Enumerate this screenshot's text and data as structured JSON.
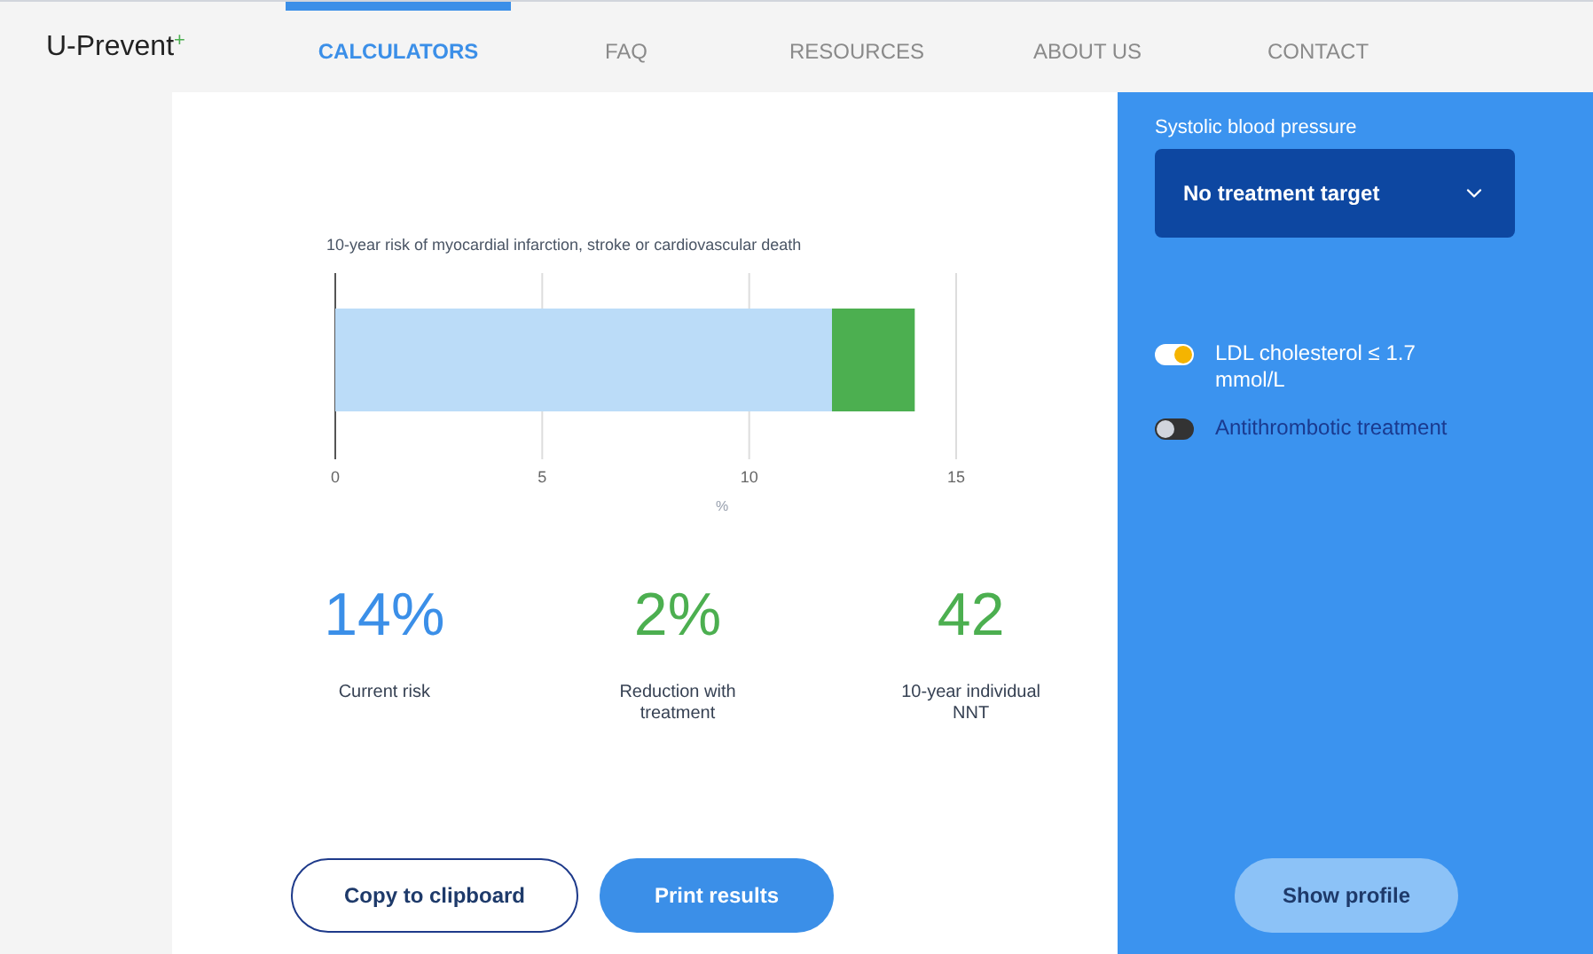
{
  "logo": {
    "text": "U-Prevent",
    "mark": "+"
  },
  "nav": [
    {
      "label": "CALCULATORS",
      "selected": true
    },
    {
      "label": "FAQ",
      "selected": false
    },
    {
      "label": "RESOURCES",
      "selected": false
    },
    {
      "label": "ABOUT US",
      "selected": false
    },
    {
      "label": "CONTACT",
      "selected": false
    }
  ],
  "chart": {
    "chart_data": {
      "type": "bar",
      "title": "10-year risk of myocardial infarction, stroke or cardiovascular death",
      "xlabel": "%",
      "orientation": "horizontal",
      "stacked": true,
      "series": [
        {
          "color": "#bbdcf8",
          "values": [
            12
          ]
        },
        {
          "color": "#4caf50",
          "values": [
            2
          ]
        }
      ],
      "xlim": [
        0,
        15
      ],
      "xticks": [
        0,
        5,
        10,
        15
      ]
    }
  },
  "stats": [
    {
      "value": "14%",
      "label": "Current risk",
      "color": "#3b8fe8"
    },
    {
      "value": "2%",
      "label": "Reduction with treatment",
      "color": "#4caf50"
    },
    {
      "value": "42",
      "label": "10-year individual NNT",
      "color": "#4caf50"
    }
  ],
  "buttons": [
    {
      "label": "Copy to clipboard",
      "kind": "outline"
    },
    {
      "label": "Print results",
      "kind": "filled"
    }
  ],
  "panel": {
    "field_label": "Systolic blood pressure",
    "select_value": "No treatment target",
    "toggles": [
      {
        "label": "LDL cholesterol ≤ 1.7 mmol/L",
        "on": true
      },
      {
        "label": "Antithrombotic treatment",
        "on": false
      }
    ],
    "profile_button": "Show profile"
  }
}
